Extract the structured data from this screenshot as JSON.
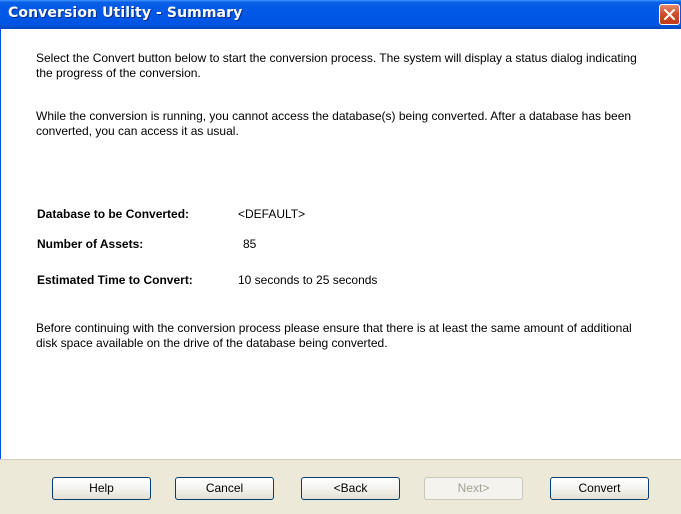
{
  "window": {
    "title": "Conversion Utility - Summary"
  },
  "intro": {
    "paragraph1": "Select the Convert button below to start the conversion process. The system will display a status dialog indicating the progress of the conversion.",
    "paragraph2": "While the conversion is running, you cannot access the database(s) being converted. After a database has been converted, you can access it as usual."
  },
  "summary": {
    "database_label": "Database to be Converted:",
    "database_value": "<DEFAULT>",
    "assets_label": "Number of Assets:",
    "assets_value": "85",
    "time_label": "Estimated Time to Convert:",
    "time_value": "10 seconds to 25 seconds"
  },
  "notice": "Before continuing with the conversion process please ensure that there is at least the same amount of additional disk space available on the drive of the database being converted.",
  "buttons": {
    "help": "Help",
    "cancel": "Cancel",
    "back": "<Back",
    "next": "Next>",
    "convert": "Convert"
  },
  "icons": {
    "close": "close-icon"
  },
  "colors": {
    "titlebar": "#0054e3",
    "close_button": "#d44e2b",
    "dialog_face": "#ece9d8"
  }
}
